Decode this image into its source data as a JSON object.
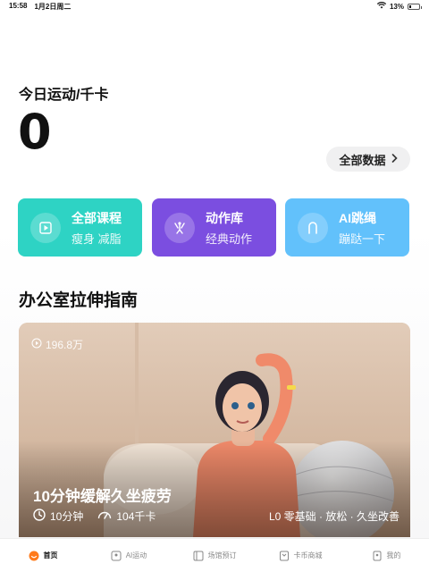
{
  "status_bar": {
    "time": "15:58",
    "date": "1月2日周二",
    "battery": "13%"
  },
  "today": {
    "label": "今日运动/千卡",
    "value": "0",
    "all_data_button": "全部数据"
  },
  "cards": [
    {
      "title": "全部课程",
      "subtitle": "瘦身 减脂",
      "icon": "play-icon",
      "color": "#2ed3c4"
    },
    {
      "title": "动作库",
      "subtitle": "经典动作",
      "icon": "stretch-icon",
      "color": "#7b4ee0"
    },
    {
      "title": "AI跳绳",
      "subtitle": "蹦跶一下",
      "icon": "jump-rope-icon",
      "color": "#62c1fb"
    }
  ],
  "section": {
    "title": "办公室拉伸指南"
  },
  "video": {
    "views": "196.8万",
    "title": "10分钟缓解久坐疲劳",
    "duration": "10分钟",
    "calories": "104千卡",
    "level": "L0 零基础 · 放松 · 久坐改善"
  },
  "tabs": [
    {
      "label": "首页",
      "icon": "home-icon",
      "active": true
    },
    {
      "label": "AI运动",
      "icon": "ai-sport-icon",
      "active": false
    },
    {
      "label": "场馆预订",
      "icon": "venue-icon",
      "active": false
    },
    {
      "label": "卡币商城",
      "icon": "shop-icon",
      "active": false
    },
    {
      "label": "我的",
      "icon": "profile-icon",
      "active": false
    }
  ],
  "colors": {
    "accent_orange": "#ff7a1a",
    "teal": "#2ed3c4",
    "purple": "#7b4ee0",
    "sky": "#62c1fb"
  }
}
